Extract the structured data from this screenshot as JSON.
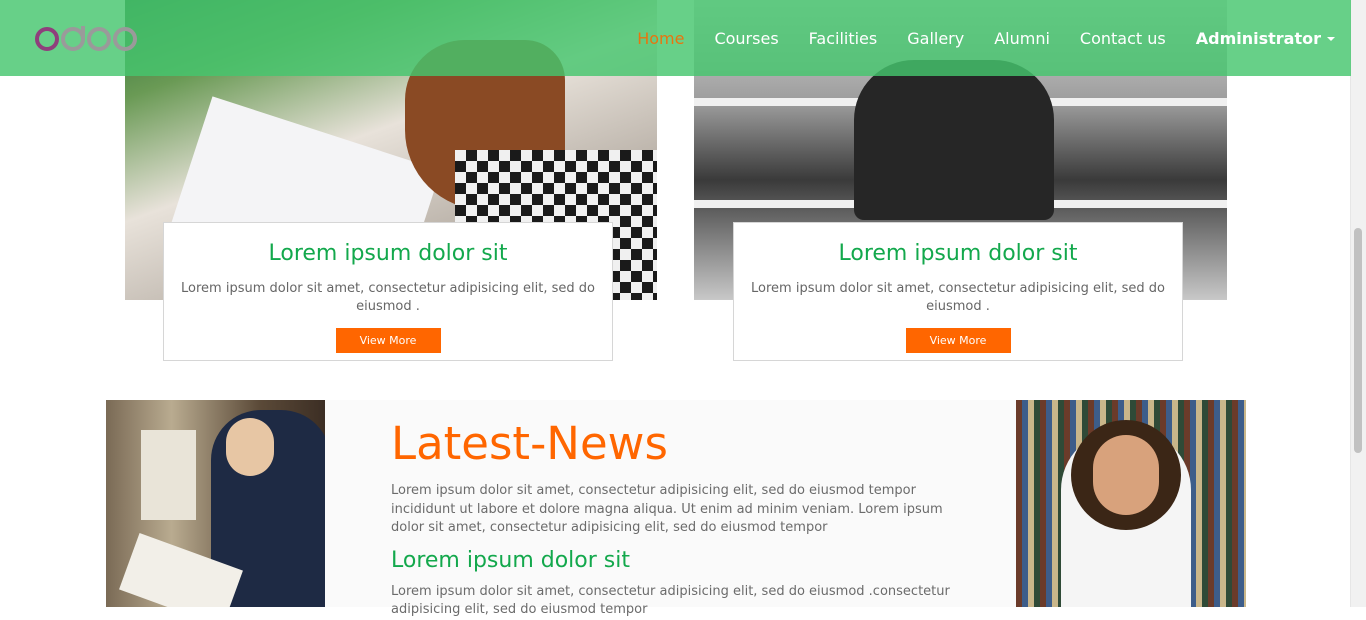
{
  "nav": {
    "logo_text": "odoo",
    "items": [
      {
        "label": "Home",
        "active": true
      },
      {
        "label": "Courses"
      },
      {
        "label": "Facilities"
      },
      {
        "label": "Gallery"
      },
      {
        "label": "Alumni"
      },
      {
        "label": "Contact us"
      }
    ],
    "user": "Administrator"
  },
  "cards": [
    {
      "title": "Lorem ipsum dolor sit",
      "text": "Lorem ipsum dolor sit amet, consectetur adipisicing elit, sed do eiusmod .",
      "button": "View More"
    },
    {
      "title": "Lorem ipsum dolor sit",
      "text": "Lorem ipsum dolor sit amet, consectetur adipisicing elit, sed do eiusmod .",
      "button": "View More"
    }
  ],
  "news": {
    "title": "Latest-News",
    "paragraph": "Lorem ipsum dolor sit amet, consectetur adipisicing elit, sed do eiusmod tempor incididunt ut labore et dolore magna aliqua. Ut enim ad minim veniam. Lorem ipsum dolor sit amet, consectetur adipisicing elit, sed do eiusmod tempor",
    "subtitle": "Lorem ipsum dolor sit",
    "paragraph2": "Lorem ipsum dolor sit amet, consectetur adipisicing elit, sed do eiusmod .consectetur adipisicing elit, sed do eiusmod tempor"
  },
  "colors": {
    "navbar": "#46c66e",
    "accent_orange": "#ff6600",
    "heading_green": "#13a84c"
  }
}
